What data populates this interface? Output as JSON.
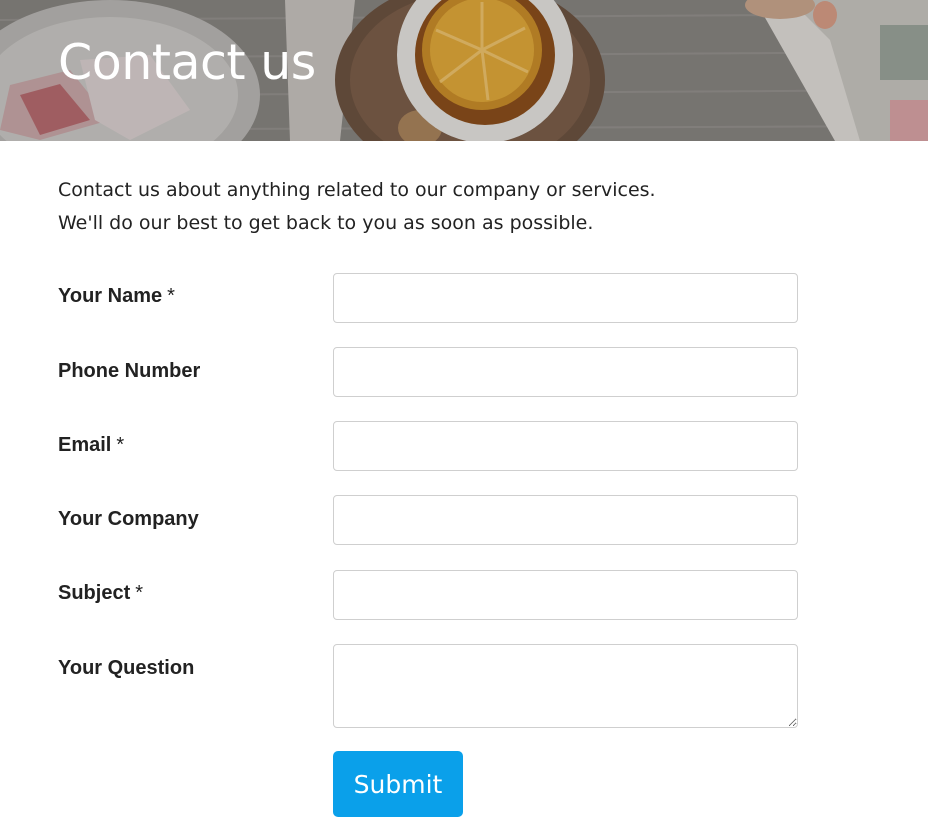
{
  "header": {
    "title": "Contact us"
  },
  "intro": {
    "line1": "Contact us about anything related to our company or services.",
    "line2": "We'll do our best to get back to you as soon as possible."
  },
  "form": {
    "fields": [
      {
        "label": "Your Name",
        "required": "*",
        "value": ""
      },
      {
        "label": "Phone Number",
        "required": "",
        "value": ""
      },
      {
        "label": "Email",
        "required": "*",
        "value": ""
      },
      {
        "label": "Your Company",
        "required": "",
        "value": ""
      },
      {
        "label": "Subject",
        "required": "*",
        "value": ""
      },
      {
        "label": "Your Question",
        "required": "",
        "value": ""
      }
    ],
    "submit_label": "Submit"
  },
  "colors": {
    "accent": "#0aa0ea",
    "text": "#222222",
    "field_border": "#cfcfcf"
  }
}
